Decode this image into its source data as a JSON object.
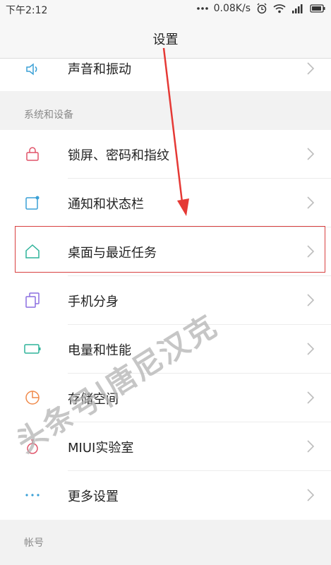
{
  "status_bar": {
    "time": "下午2:12",
    "network_speed": "0.08K/s",
    "icons": [
      "more-dots-icon",
      "alarm-icon",
      "wifi-icon",
      "signal-icon",
      "battery-icon"
    ]
  },
  "header": {
    "title": "设置"
  },
  "top_item": {
    "label": "声音和振动",
    "icon": "speaker-icon"
  },
  "section_system": {
    "title": "系统和设备",
    "items": [
      {
        "label": "锁屏、密码和指纹",
        "icon": "lock-icon",
        "color": "#e0546a"
      },
      {
        "label": "通知和状态栏",
        "icon": "notification-icon",
        "color": "#3aa0d6"
      },
      {
        "label": "桌面与最近任务",
        "icon": "home-icon",
        "color": "#2fb39a"
      },
      {
        "label": "手机分身",
        "icon": "dual-copy-icon",
        "color": "#8b6fe0"
      },
      {
        "label": "电量和性能",
        "icon": "battery-icon",
        "color": "#2fb39a"
      },
      {
        "label": "存储空间",
        "icon": "pie-chart-icon",
        "color": "#f08a4b"
      },
      {
        "label": "MIUI实验室",
        "icon": "flask-icon",
        "color": "#e0546a"
      },
      {
        "label": "更多设置",
        "icon": "more-dots-icon",
        "color": "#3aa0d6"
      }
    ]
  },
  "section_account": {
    "title": "帐号"
  },
  "highlight_color": "#d94040",
  "arrow_color": "#e53935",
  "watermark": "头条号|唐尼汉克"
}
